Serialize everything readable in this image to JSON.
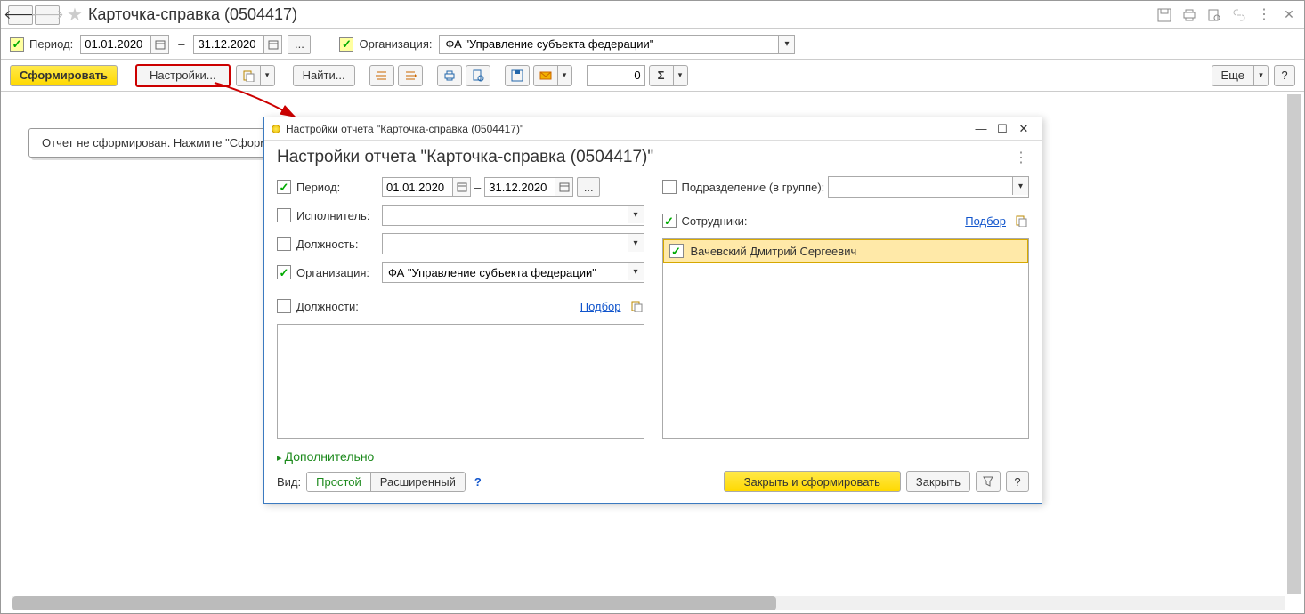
{
  "titlebar": {
    "title": "Карточка-справка (0504417)"
  },
  "filter": {
    "period_label": "Период:",
    "date_from": "01.01.2020",
    "dash": "–",
    "date_to": "31.12.2020",
    "org_label": "Организация:",
    "org_value": "ФА \"Управление субъекта федерации\""
  },
  "toolbar": {
    "form": "Сформировать",
    "settings": "Настройки...",
    "find": "Найти...",
    "num": "0",
    "more": "Еще",
    "help": "?"
  },
  "content": {
    "info": "Отчет не сформирован. Нажмите \"Сформ"
  },
  "dialog": {
    "titlebar": "Настройки отчета \"Карточка-справка (0504417)\"",
    "heading": "Настройки отчета \"Карточка-справка (0504417)\"",
    "left": {
      "period_label": "Период:",
      "date_from": "01.01.2020",
      "dash": "–",
      "date_to": "31.12.2020",
      "executor_label": "Исполнитель:",
      "position_label": "Должность:",
      "org_label": "Организация:",
      "org_value": "ФА \"Управление субъекта федерации\"",
      "positions_label": "Должности:",
      "pick": "Подбор"
    },
    "right": {
      "dept_label": "Подразделение (в группе):",
      "employees_label": "Сотрудники:",
      "pick": "Подбор",
      "employee_0": "Вачевский Дмитрий Сергеевич"
    },
    "additional": "Дополнительно",
    "footer": {
      "view_label": "Вид:",
      "simple": "Простой",
      "extended": "Расширенный",
      "close_form": "Закрыть и сформировать",
      "close": "Закрыть",
      "help": "?"
    }
  }
}
